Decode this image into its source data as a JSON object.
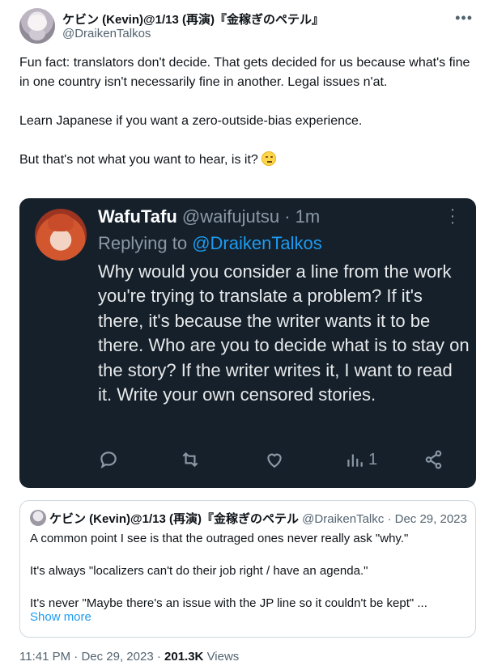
{
  "tweet": {
    "author_name": "ケビン (Kevin)@1/13 (再演)『金稼ぎのペテル』",
    "author_handle": "@DraikenTalkos",
    "more_icon": "more-horizontal-icon",
    "paragraphs": [
      "Fun fact: translators don't decide. That gets decided for us because what's fine in one country isn't necessarily fine in another. Legal issues n'at.",
      "Learn Japanese if you want a zero-outside-bias experience.",
      "But that's not what you want to hear, is it?"
    ],
    "emoji": "face-with-rolling-eyes"
  },
  "embedded": {
    "name": "WafuTafu",
    "handle": "@waifujutsu",
    "separator": "·",
    "time": "1m",
    "replying_prefix": "Replying to",
    "replying_to": "@DraikenTalkos",
    "body": "Why would you consider a line from the work you're trying to translate a problem? If it's there, it's because the writer wants it to be there. Who are you to decide what is to stay on the story? If the writer writes it, I want to read it. Write your own censored stories.",
    "actions": {
      "reply_icon": "reply-icon",
      "retweet_icon": "retweet-icon",
      "like_icon": "heart-icon",
      "views_icon": "analytics-icon",
      "views_count": "1",
      "share_icon": "share-icon"
    },
    "background": "#15202b"
  },
  "quote": {
    "name": "ケビン (Kevin)@1/13 (再演)『金稼ぎのペテル",
    "handle": "@DraikenTalkc",
    "separator": "·",
    "date": "Dec 29, 2023",
    "lines": [
      "A common point I see is that the outraged ones never really ask \"why.\"",
      "It's always \"localizers can't do their job right / have an agenda.\"",
      "It's never \"Maybe there's an issue with the JP line so it couldn't be kept\" ..."
    ],
    "show_more": "Show more"
  },
  "footer": {
    "time": "11:41 PM",
    "separator": "·",
    "date": "Dec 29, 2023",
    "views_count": "201.3K",
    "views_label": "Views"
  },
  "colors": {
    "accent": "#1d9bf0",
    "muted": "#536471",
    "dark_muted": "#8b98a5"
  }
}
